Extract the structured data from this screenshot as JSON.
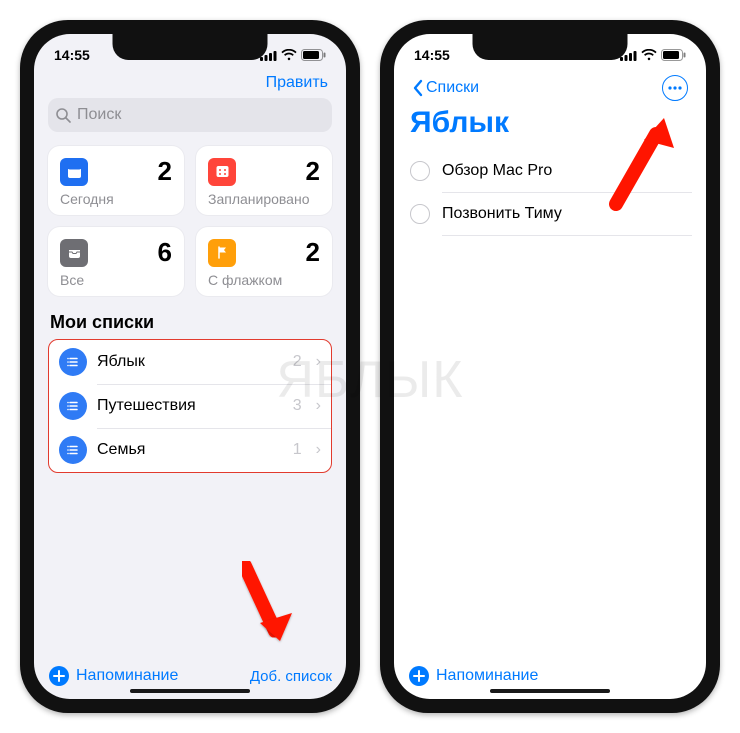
{
  "status": {
    "time": "14:55"
  },
  "left": {
    "nav_edit": "Править",
    "search_placeholder": "Поиск",
    "tiles": {
      "today": {
        "label": "Сегодня",
        "count": "2",
        "bg": "#1f6ff1",
        "glyph": "calendar"
      },
      "planned": {
        "label": "Запланировано",
        "count": "2",
        "bg": "#ff453a",
        "glyph": "calendar-dots"
      },
      "all": {
        "label": "Все",
        "count": "6",
        "bg": "#6e6e73",
        "glyph": "tray"
      },
      "flagged": {
        "label": "С флажком",
        "count": "2",
        "bg": "#ff9f0a",
        "glyph": "flag"
      }
    },
    "section_title": "Мои списки",
    "lists": [
      {
        "name": "Яблык",
        "count": "2"
      },
      {
        "name": "Путешествия",
        "count": "3"
      },
      {
        "name": "Семья",
        "count": "1"
      }
    ],
    "add_reminder": "Напоминание",
    "add_list": "Доб. список"
  },
  "right": {
    "back": "Списки",
    "title": "Яблык",
    "items": [
      {
        "text": "Обзор Mac Pro"
      },
      {
        "text": "Позвонить Тиму"
      }
    ],
    "add_reminder": "Напоминание"
  },
  "watermark": "ЯБЛЫК"
}
